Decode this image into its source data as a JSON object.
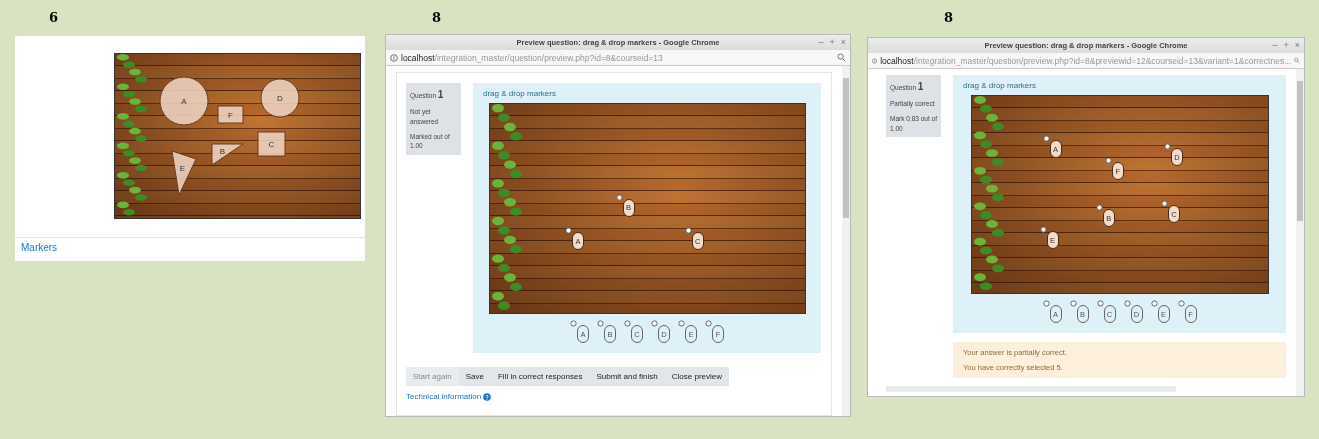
{
  "panels": [
    {
      "kind": "editor",
      "label": "6",
      "shapes": [
        {
          "kind": "circle",
          "label": "A"
        },
        {
          "kind": "circle",
          "label": "D"
        },
        {
          "kind": "rect",
          "label": "F"
        },
        {
          "kind": "rect",
          "label": "C"
        },
        {
          "kind": "triangle",
          "label": "B"
        },
        {
          "kind": "triangle",
          "label": "E"
        }
      ],
      "section_link": "Markers"
    },
    {
      "kind": "preview",
      "label": "8",
      "window": {
        "title": "Preview question: drag & drop markers - Google Chrome",
        "controls": [
          "–",
          "+",
          "×"
        ],
        "url_host": "localhost",
        "url_path": "/integration_master/question/preview.php?id=8&courseid=13"
      },
      "info": {
        "prefix": "Question",
        "number": "1",
        "status": "Not yet answered",
        "mark": "Marked out of 1.00"
      },
      "heading": "drag & drop markers",
      "placed_markers": [
        {
          "label": "B"
        },
        {
          "label": "A"
        },
        {
          "label": "C"
        }
      ],
      "tray_markers": [
        "A",
        "B",
        "C",
        "D",
        "E",
        "F"
      ],
      "buttons": [
        {
          "label": "Start again",
          "disabled": true
        },
        {
          "label": "Save",
          "disabled": false
        },
        {
          "label": "Fill in correct responses",
          "disabled": false
        },
        {
          "label": "Submit and finish",
          "disabled": false
        },
        {
          "label": "Close preview",
          "disabled": false
        }
      ],
      "tech_link": "Technical information"
    },
    {
      "kind": "preview",
      "label": "8",
      "window": {
        "title": "Preview question: drag & drop markers - Google Chrome",
        "controls": [
          "–",
          "+",
          "×"
        ],
        "url_host": "localhost",
        "url_path": "/integration_master/question/preview.php?id=8&previewid=12&courseid=13&variant=1&correctnes..."
      },
      "info": {
        "prefix": "Question",
        "number": "1",
        "status": "Partially correct",
        "mark": "Mark 0.83 out of 1.00"
      },
      "heading": "drag & drop markers",
      "placed_markers": [
        {
          "label": "A"
        },
        {
          "label": "D"
        },
        {
          "label": "F"
        },
        {
          "label": "B"
        },
        {
          "label": "C"
        },
        {
          "label": "E"
        }
      ],
      "tray_markers": [
        "A",
        "B",
        "C",
        "D",
        "E",
        "F"
      ],
      "feedback": [
        "Your answer is partially correct.",
        "You have correctly selected 5."
      ]
    }
  ]
}
